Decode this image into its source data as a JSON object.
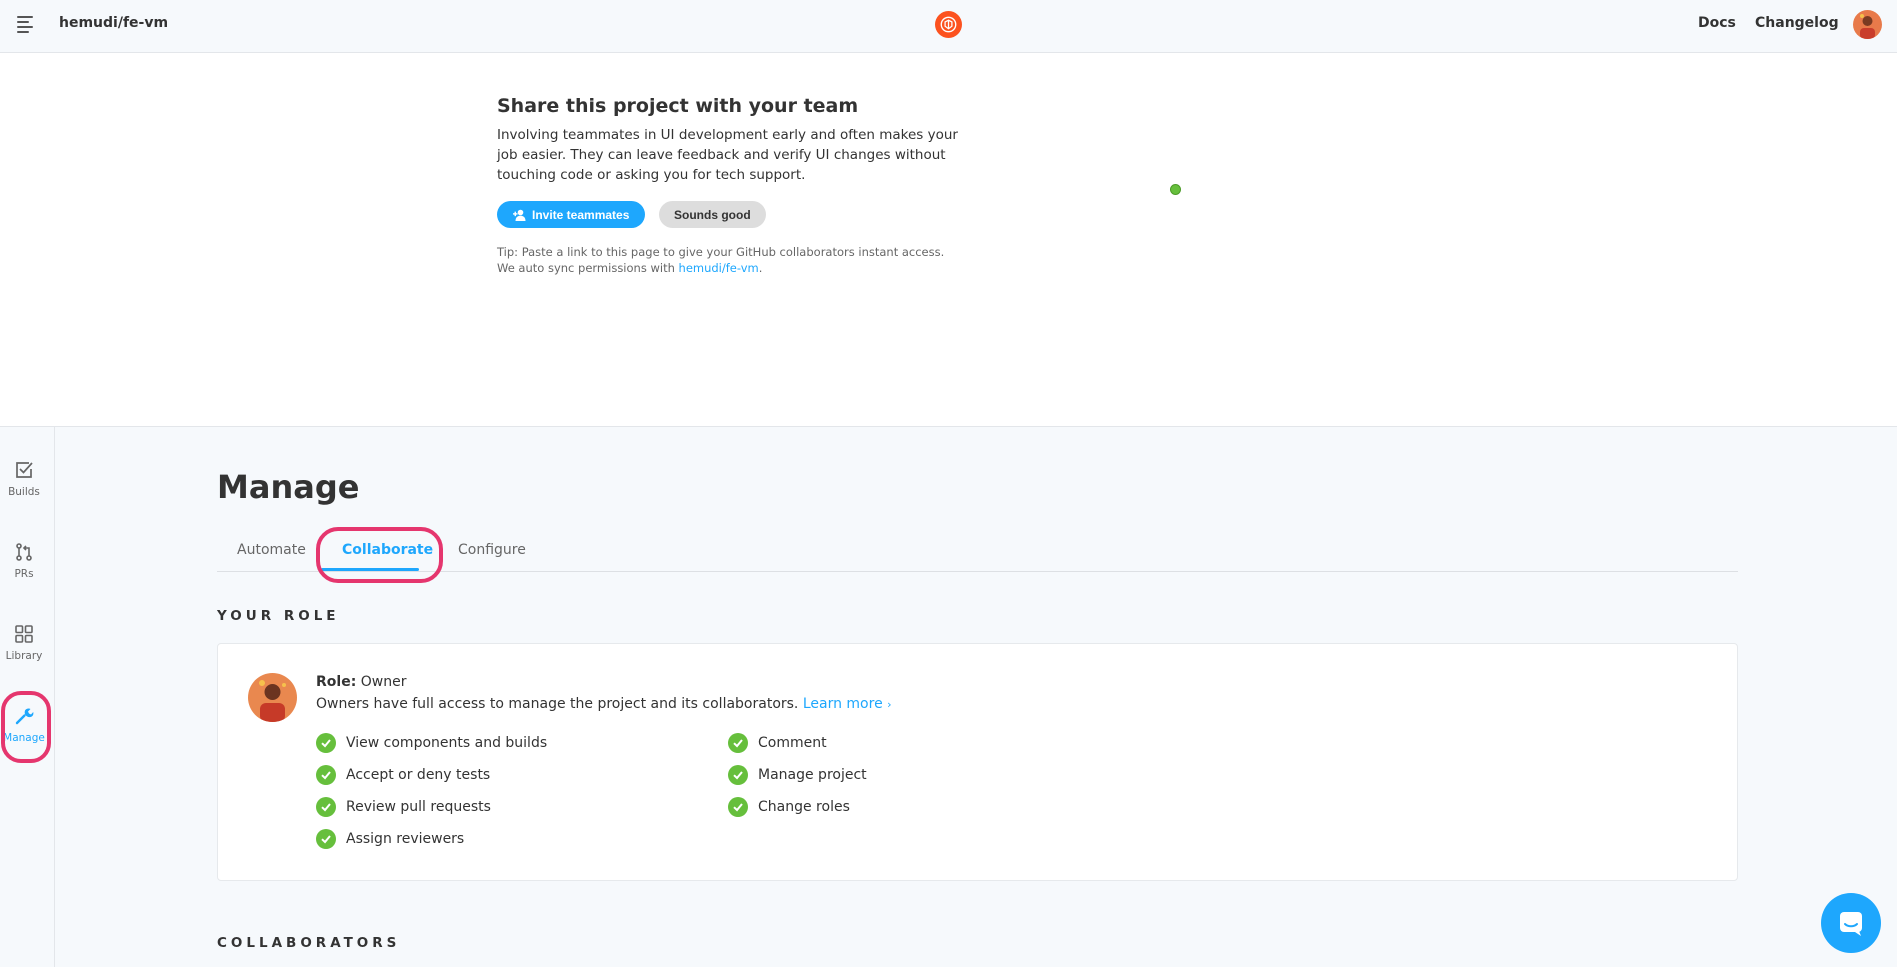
{
  "header": {
    "project": "hemudi/fe-vm",
    "docs": "Docs",
    "changelog": "Changelog"
  },
  "share": {
    "title": "Share this project with your team",
    "description": "Involving teammates in UI development early and often makes your job easier. They can leave feedback and verify UI changes without touching code or asking you for tech support.",
    "invite_label": "Invite teammates",
    "sounds_good_label": "Sounds good",
    "tip_line1": "Tip: Paste a link to this page to give your GitHub collaborators instant access.",
    "tip_line2_prefix": "We auto sync permissions with ",
    "tip_link": "hemudi/fe-vm",
    "tip_suffix": "."
  },
  "sidebar": {
    "items": [
      {
        "label": "Builds",
        "icon": "checkbox-icon"
      },
      {
        "label": "PRs",
        "icon": "pull-request-icon"
      },
      {
        "label": "Library",
        "icon": "grid-icon"
      },
      {
        "label": "Manage",
        "icon": "wrench-icon"
      }
    ]
  },
  "main": {
    "title": "Manage",
    "tabs": [
      {
        "label": "Automate"
      },
      {
        "label": "Collaborate"
      },
      {
        "label": "Configure"
      }
    ],
    "your_role_heading": "YOUR ROLE",
    "role_label": "Role:",
    "role_value": "Owner",
    "role_description": "Owners have full access to manage the project and its collaborators.",
    "learn_more": "Learn more",
    "permissions_left": [
      "View components and builds",
      "Accept or deny tests",
      "Review pull requests",
      "Assign reviewers"
    ],
    "permissions_right": [
      "Comment",
      "Manage project",
      "Change roles"
    ],
    "collaborators_heading": "COLLABORATORS"
  },
  "colors": {
    "accent": "#1ea7fd",
    "brand": "#fc521f",
    "highlight": "#e5366e",
    "success": "#66bf3c"
  }
}
